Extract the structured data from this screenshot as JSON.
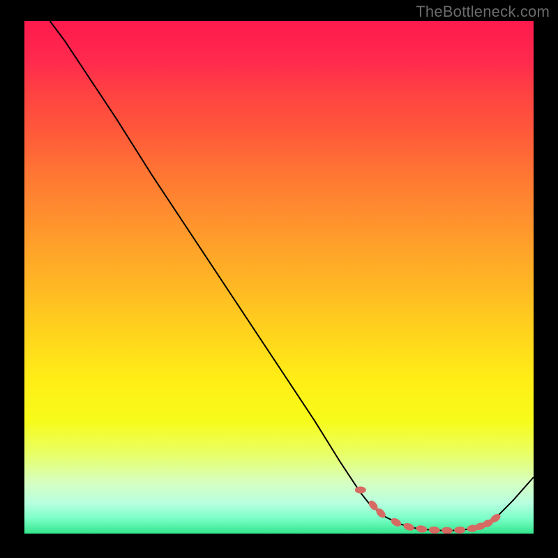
{
  "watermark": "TheBottleneck.com",
  "chart_data": {
    "type": "line",
    "title": "",
    "xlabel": "",
    "ylabel": "",
    "xlim": [
      0,
      100
    ],
    "ylim": [
      0,
      100
    ],
    "grid": false,
    "legend": false,
    "series": [
      {
        "name": "curve",
        "x": [
          5,
          8,
          12,
          18,
          25,
          33,
          41,
          49,
          57,
          62,
          66,
          68,
          71,
          74,
          77,
          80,
          82,
          84,
          86,
          88,
          90,
          93,
          96,
          100
        ],
        "y": [
          100,
          96,
          90,
          81,
          70,
          58,
          46,
          34,
          22,
          14,
          8,
          5.5,
          3.2,
          1.8,
          1.0,
          0.7,
          0.6,
          0.6,
          0.7,
          1.0,
          1.6,
          3.5,
          6.5,
          11
        ]
      }
    ],
    "markers": {
      "name": "highlight-points",
      "color": "#d66b63",
      "x": [
        66.0,
        68.5,
        70.0,
        73.0,
        75.5,
        78.0,
        80.5,
        83.0,
        85.5,
        88.0,
        89.5,
        91.0,
        92.5
      ],
      "y": [
        8.5,
        5.5,
        4.0,
        2.2,
        1.3,
        0.9,
        0.7,
        0.6,
        0.7,
        1.0,
        1.4,
        2.0,
        3.0
      ]
    },
    "gradient_colors": {
      "top": "#ff1a4d",
      "upper_mid": "#ff8833",
      "mid": "#ffd020",
      "lower_mid": "#f5ff30",
      "bottom": "#33e68c"
    }
  }
}
